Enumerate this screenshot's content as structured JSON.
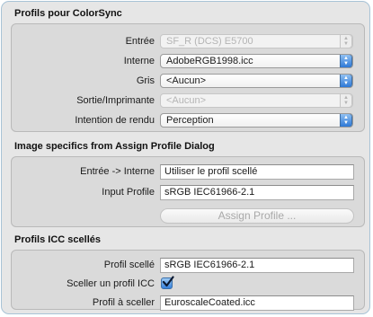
{
  "colorsync": {
    "title": "Profils pour ColorSync",
    "rows": [
      {
        "label": "Entrée",
        "value": "SF_R (DCS) E5700",
        "disabled": true
      },
      {
        "label": "Interne",
        "value": "AdobeRGB1998.icc",
        "disabled": false
      },
      {
        "label": "Gris",
        "value": "<Aucun>",
        "disabled": false
      },
      {
        "label": "Sortie/Imprimante",
        "value": "<Aucun>",
        "disabled": true
      },
      {
        "label": "Intention de rendu",
        "value": "Perception",
        "disabled": false
      }
    ]
  },
  "assign": {
    "title": "Image specifics from Assign Profile Dialog",
    "entree_interne_label": "Entrée -> Interne",
    "entree_interne_value": "Utiliser le profil scellé",
    "input_profile_label": "Input Profile",
    "input_profile_value": "sRGB IEC61966-2.1",
    "assign_button": "Assign Profile ..."
  },
  "icc": {
    "title": "Profils ICC scellés",
    "profil_scelle_label": "Profil scellé",
    "profil_scelle_value": "sRGB IEC61966-2.1",
    "sceller_label": "Sceller un profil ICC",
    "sceller_checked": true,
    "profil_a_sceller_label": "Profil à sceller",
    "profil_a_sceller_value": "EuroscaleCoated.icc"
  }
}
